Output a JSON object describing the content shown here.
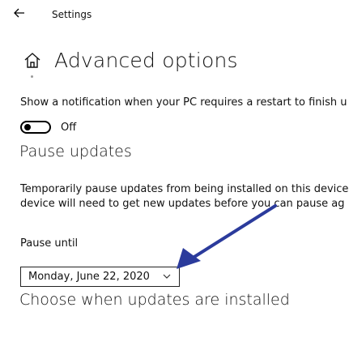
{
  "header": {
    "back_icon": "back-arrow-icon",
    "app_title": "Settings"
  },
  "page": {
    "home_icon": "home-icon",
    "title": "Advanced options"
  },
  "notification": {
    "text": "Show a notification when your PC requires a restart to finish u",
    "toggle_state": "Off"
  },
  "pause_updates": {
    "heading": "Pause updates",
    "description_line1": "Temporarily pause updates from being installed on this device",
    "description_line2": "device will need to get new updates before you can pause ag",
    "pause_until_label": "Pause until",
    "date_selected": "Monday, June 22, 2020",
    "chevron_icon": "chevron-down-icon"
  },
  "choose_updates": {
    "heading": "Choose when updates are installed"
  },
  "colors": {
    "annotation_arrow": "#2b3b9c"
  }
}
